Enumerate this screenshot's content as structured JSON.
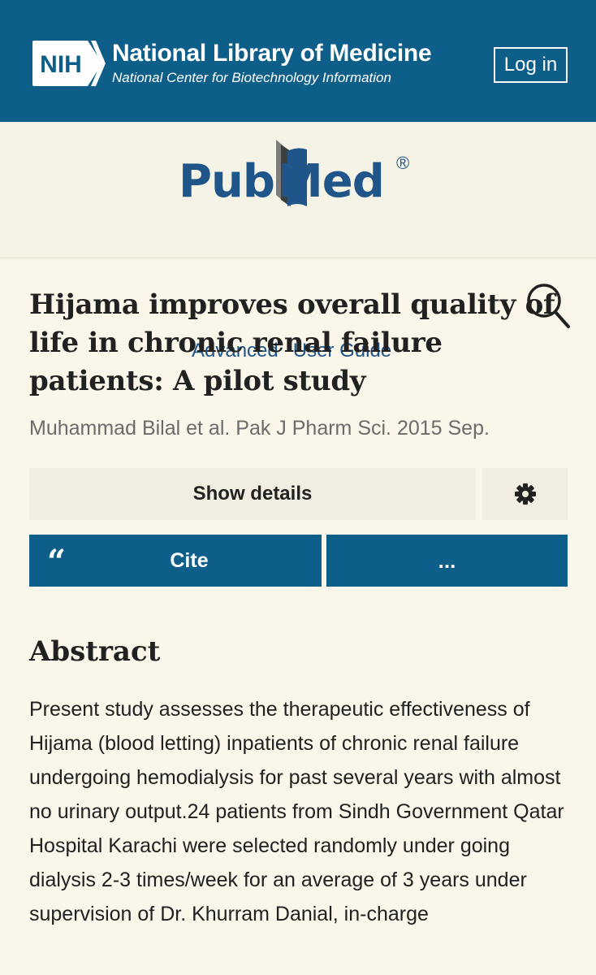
{
  "nih_banner": {
    "badge_text": "NIH",
    "title": "National Library of Medicine",
    "subtitle": "National Center for Biotechnology Information",
    "login_label": "Log in",
    "background_color": "#0d5f8a"
  },
  "pubmed_header": {
    "logo_pub": "Pub",
    "logo_med": "Med",
    "logo_registered": "®",
    "links": [
      "Advanced",
      "User Guide"
    ],
    "search_icon": "search-icon",
    "brand_color": "#20558a"
  },
  "article": {
    "title": "Hijama improves overall quality of life in chronic renal failure patients: A pilot study",
    "citation": "Muhammad Bilal et al. Pak J Pharm Sci. 2015 Sep.",
    "show_details_label": "Show details",
    "settings_icon": "gear-icon",
    "cite_icon": "“",
    "cite_label": "Cite",
    "more_label": "..."
  },
  "abstract": {
    "heading": "Abstract",
    "text": "Present study assesses the therapeutic effectiveness of Hijama (blood letting) inpatients of chronic renal failure undergoing hemodialysis for past several years with almost no urinary output.24 patients from Sindh Government Qatar Hospital Karachi were selected randomly under going dialysis 2-3 times/week for an average of 3 years under supervision of Dr. Khurram Danial, in-charge"
  }
}
